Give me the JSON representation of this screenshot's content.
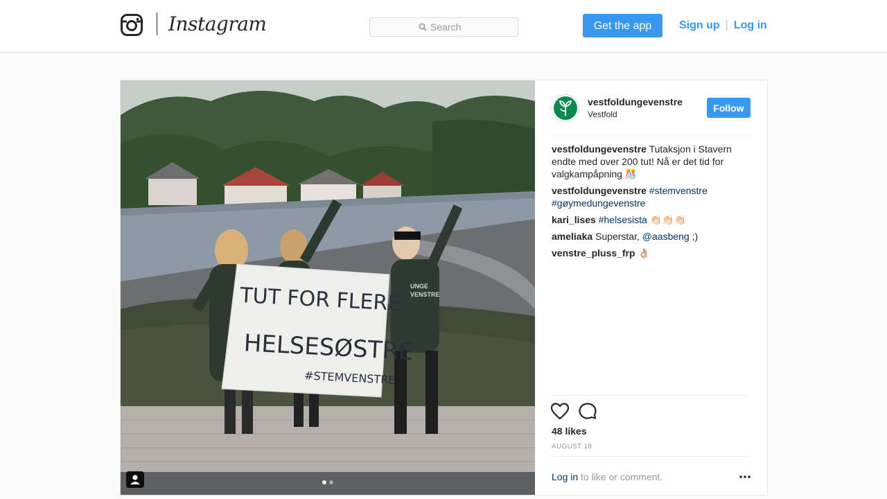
{
  "header": {
    "brand_name": "Instagram",
    "search_placeholder": "Search",
    "get_app_label": "Get the app",
    "signup_label": "Sign up",
    "divider": "|",
    "login_label": "Log in",
    "accent_color": "#3897f0"
  },
  "post": {
    "username": "vestfoldungevenstre",
    "location": "Vestfold",
    "follow_label": "Follow",
    "photo_sign_lines": [
      "TUT FOR FLERE",
      "HELSESØSTRE",
      "#STEMVENSTRE"
    ],
    "shirt_text": [
      "UNGE",
      "VENSTRE"
    ],
    "carousel": {
      "slide_count": 2,
      "active_index": 0
    },
    "comments": [
      {
        "user": "vestfoldungevenstre",
        "text": "Tutaksjon i Stavern endte med over 200 tut! Nå er det tid for valgkampåpning 🎊"
      },
      {
        "user": "vestfoldungevenstre",
        "tags": [
          "#stemvenstre",
          "#gøymedungevenstre"
        ]
      },
      {
        "user": "kari_lises",
        "tag": "#helsesista",
        "trail": "👏🏻👏🏻👏🏻"
      },
      {
        "user": "ameliaka",
        "text": "Superstar,",
        "mention": "@aasbeng",
        "trail": ";)"
      },
      {
        "user": "venstre_pluss_frp",
        "text": "👌🏼"
      }
    ],
    "likes": "48 likes",
    "date": "AUGUST 18",
    "login_link": "Log in",
    "login_suffix": " to like or comment."
  },
  "icons": {
    "logo": "instagram-camera-icon",
    "search": "search-icon",
    "avatar_logo": "venstre-flower-icon",
    "tag": "user-tag-icon",
    "like": "heart-icon",
    "comment": "comment-bubble-icon",
    "more": "more-options-icon"
  }
}
